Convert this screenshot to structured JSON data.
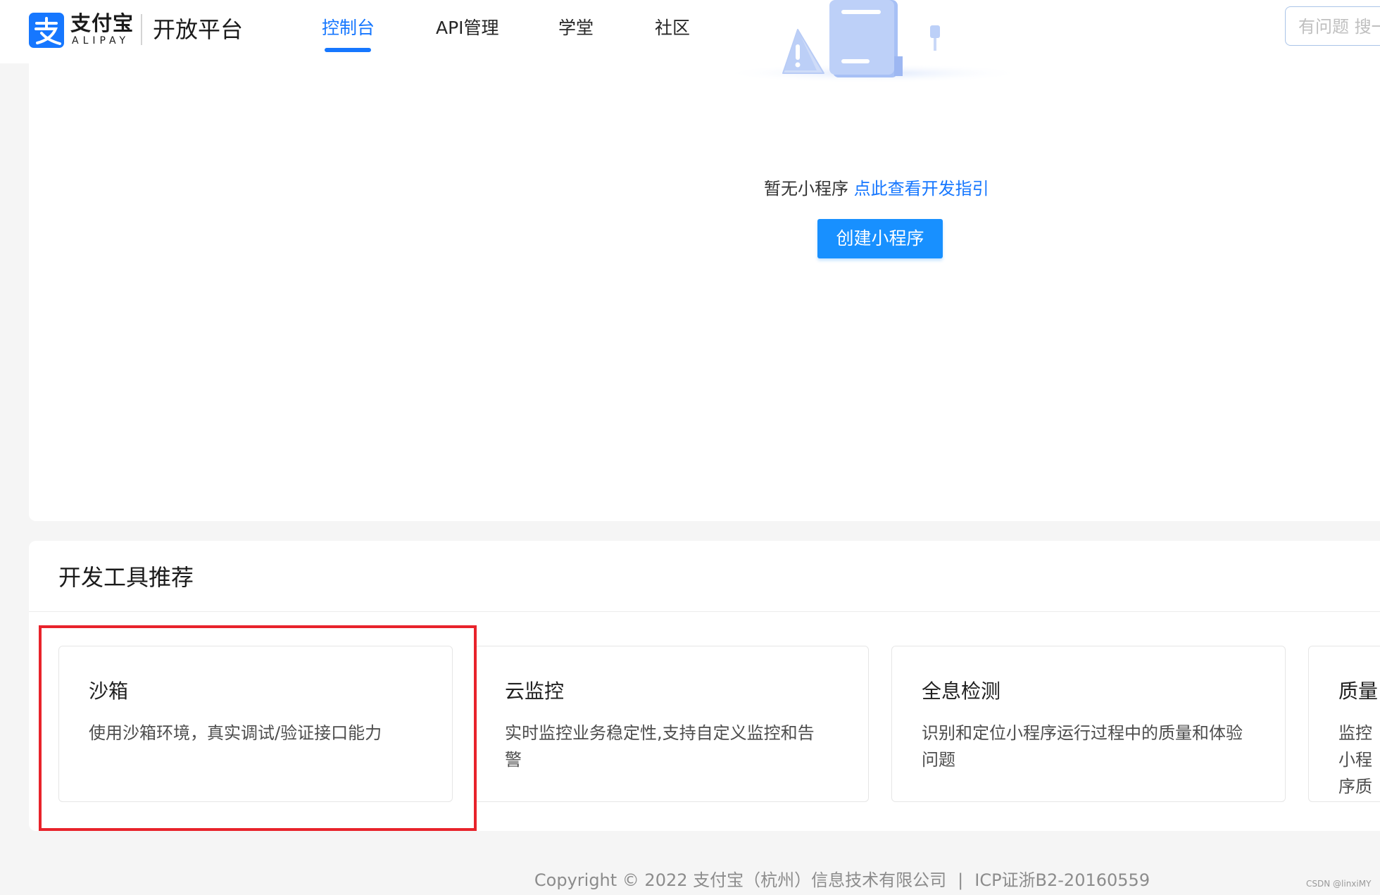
{
  "header": {
    "logo_cn": "支付宝",
    "logo_en": "ALIPAY",
    "platform_title": "开放平台",
    "nav": [
      {
        "label": "控制台",
        "active": true
      },
      {
        "label": "API管理",
        "active": false
      },
      {
        "label": "学堂",
        "active": false
      },
      {
        "label": "社区",
        "active": false
      }
    ],
    "search_placeholder": "有问题 搜一搜"
  },
  "empty_state": {
    "text": "暂无小程序",
    "link": "点此查看开发指引",
    "create_button": "创建小程序"
  },
  "tools": {
    "title": "开发工具推荐",
    "items": [
      {
        "name": "沙箱",
        "desc": "使用沙箱环境，真实调试/验证接口能力"
      },
      {
        "name": "云监控",
        "desc": "实时监控业务稳定性,支持自定义监控和告警"
      },
      {
        "name": "全息检测",
        "desc": "识别和定位小程序运行过程中的质量和体验问题"
      },
      {
        "name": "质量",
        "desc": "监控小程序质量和解决"
      }
    ]
  },
  "footer": {
    "copyright": "Copyright © 2022 支付宝（杭州）信息技术有限公司",
    "separator": "|",
    "icp": "ICP证浙B2-20160559"
  },
  "watermark": "CSDN @linxiMY",
  "colors": {
    "brand": "#1677ff",
    "primary_button": "#1890ff",
    "highlight": "#e8232b",
    "background": "#f5f5f5"
  },
  "icons": [
    "alipay-logo-icon",
    "empty-state-illustration"
  ]
}
